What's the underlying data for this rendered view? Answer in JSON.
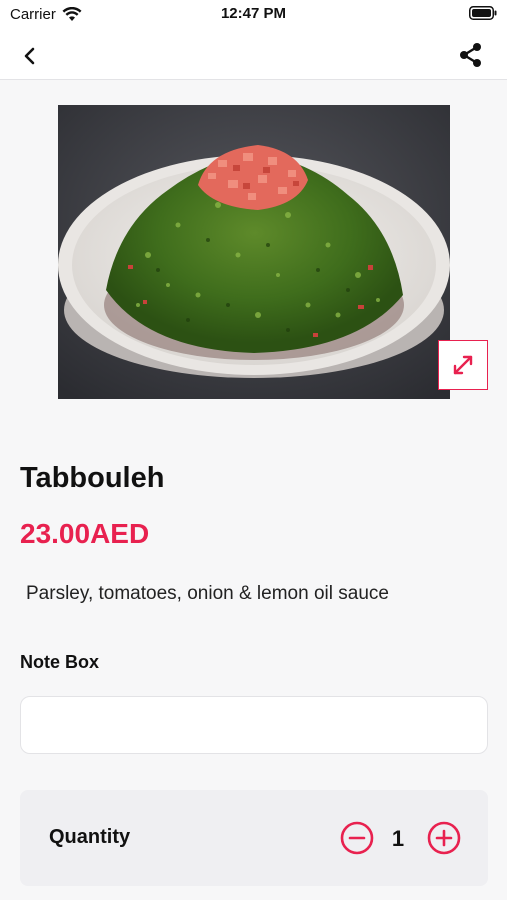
{
  "status_bar": {
    "carrier": "Carrier",
    "time": "12:47 PM",
    "icons": [
      "wifi-icon",
      "battery-icon"
    ]
  },
  "nav": {
    "icons": [
      "back-chevron-icon",
      "share-icon"
    ]
  },
  "product": {
    "image_description_icon": "tabbouleh-salad-photo",
    "title": "Tabbouleh",
    "price": "23.00AED",
    "description": "Parsley, tomatoes, onion & lemon oil sauce"
  },
  "note": {
    "label": "Note Box",
    "value": "",
    "placeholder": ""
  },
  "quantity": {
    "label": "Quantity",
    "value": "1"
  },
  "colors": {
    "accent": "#e8214f",
    "background": "#f7f7f8",
    "card": "#efeff2"
  }
}
